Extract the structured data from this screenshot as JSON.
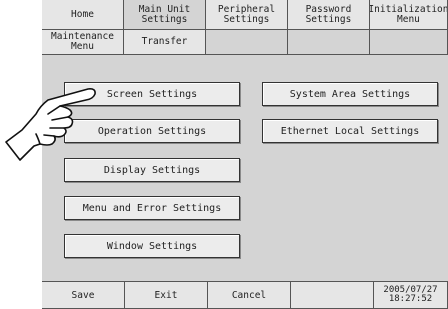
{
  "tabs_row1": [
    "Home",
    "Main Unit\nSettings",
    "Peripheral\nSettings",
    "Password\nSettings",
    "Initialization\nMenu"
  ],
  "tabs_row2": [
    "Maintenance\nMenu",
    "Transfer",
    "",
    "",
    ""
  ],
  "left_buttons": [
    "Screen Settings",
    "Operation Settings",
    "Display Settings",
    "Menu and Error Settings",
    "Window Settings"
  ],
  "right_buttons": [
    "System Area Settings",
    "Ethernet Local Settings"
  ],
  "bottom": {
    "save": "Save",
    "exit": "Exit",
    "cancel": "Cancel",
    "datetime": "2005/07/27\n18:27:52"
  },
  "icons": [
    "pointing-hand-icon"
  ]
}
